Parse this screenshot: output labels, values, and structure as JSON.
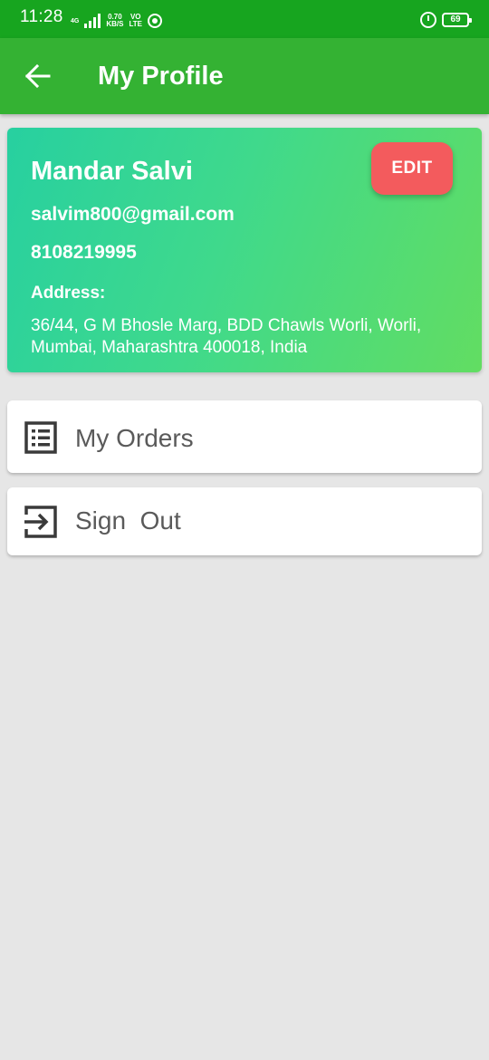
{
  "status_bar": {
    "time": "11:28",
    "network_type": "4G",
    "speed_value": "0.70",
    "speed_unit": "KB/S",
    "volte_top": "VO",
    "volte_bottom": "LTE",
    "battery": "69"
  },
  "app_bar": {
    "title": "My Profile",
    "back_icon": "arrow-left-icon"
  },
  "profile": {
    "name": "Mandar Salvi",
    "email": "salvim800@gmail.com",
    "phone": "8108219995",
    "address_label": "Address:",
    "address": "36/44, G M Bhosle Marg, BDD Chawls Worli, Worli, Mumbai, Maharashtra 400018, India",
    "edit_label": "EDIT"
  },
  "menu": {
    "orders": {
      "label": "My Orders",
      "icon": "list-icon"
    },
    "sign_out": {
      "label": "Sign  Out",
      "icon": "sign-out-icon"
    }
  },
  "colors": {
    "status_bar": "#17a51f",
    "app_bar": "#34b233",
    "card_gradient_start": "#27d0a0",
    "card_gradient_end": "#62dd62",
    "edit_button": "#f35b5d",
    "background": "#e6e6e6",
    "menu_text": "#5a5a5a"
  }
}
